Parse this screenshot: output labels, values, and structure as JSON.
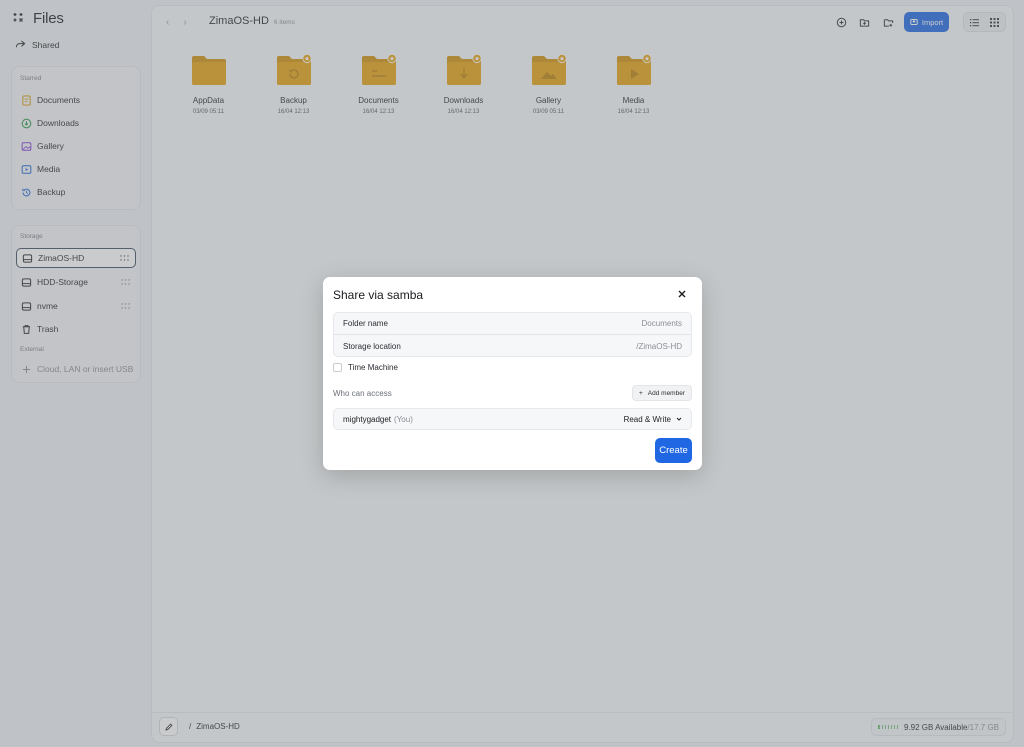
{
  "app": {
    "title": "Files"
  },
  "sidebar": {
    "shared_label": "Shared",
    "starred": {
      "title": "Starred",
      "items": [
        {
          "label": "Documents",
          "icon": "document-icon",
          "color": "#d9a11a"
        },
        {
          "label": "Downloads",
          "icon": "download-icon",
          "color": "#2e9a4b"
        },
        {
          "label": "Gallery",
          "icon": "gallery-icon",
          "color": "#8a4fd6"
        },
        {
          "label": "Media",
          "icon": "media-icon",
          "color": "#2f6fd6"
        },
        {
          "label": "Backup",
          "icon": "backup-icon",
          "color": "#2f6fd6"
        }
      ]
    },
    "storage": {
      "title": "Storage",
      "items": [
        {
          "label": "ZimaOS-HD",
          "active": true
        },
        {
          "label": "HDD-Storage"
        },
        {
          "label": "nvme"
        },
        {
          "label": "Trash"
        }
      ],
      "external_title": "External",
      "external_action": "Cloud, LAN or insert USB"
    }
  },
  "main": {
    "title": "ZimaOS-HD",
    "count": "6 items",
    "import_label": "Import",
    "files": [
      {
        "name": "AppData",
        "date": "03/09 05:11",
        "badge": false,
        "glyph": ""
      },
      {
        "name": "Backup",
        "date": "16/04 12:13",
        "badge": true,
        "glyph": "backup"
      },
      {
        "name": "Documents",
        "date": "16/04 12:13",
        "badge": true,
        "glyph": "documents"
      },
      {
        "name": "Downloads",
        "date": "16/04 12:13",
        "badge": true,
        "glyph": "downloads"
      },
      {
        "name": "Gallery",
        "date": "03/09 05:11",
        "badge": true,
        "glyph": "gallery"
      },
      {
        "name": "Media",
        "date": "16/04 12:13",
        "badge": true,
        "glyph": "media"
      }
    ],
    "bottom": {
      "path_sep": "/",
      "path": "ZimaOS-HD",
      "available": "9.92 GB Available",
      "total": "/17.7 GB"
    }
  },
  "modal": {
    "title": "Share via samba",
    "folder_label": "Folder name",
    "folder_value": "Documents",
    "location_label": "Storage location",
    "location_value": "/ZimaOS-HD",
    "time_machine_label": "Time Machine",
    "who_label": "Who can access",
    "add_member_label": "Add member",
    "member_name": "mightygadget",
    "member_you": "(You)",
    "member_permission": "Read & Write",
    "create_label": "Create"
  },
  "colors": {
    "accent": "#1f67e3",
    "folder": "#e6a10c",
    "folder_dark": "#cf8f08"
  }
}
